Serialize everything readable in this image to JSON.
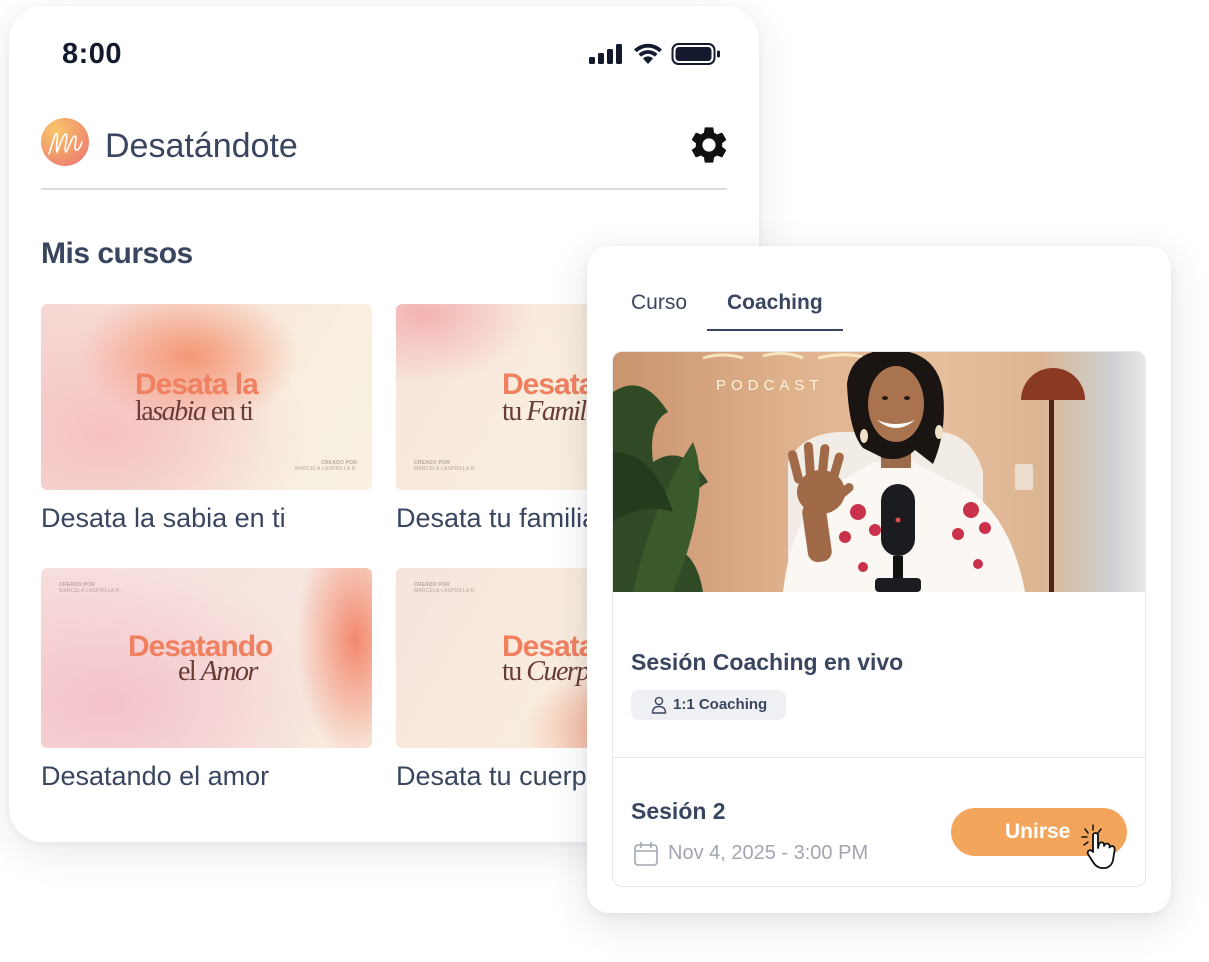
{
  "status_bar": {
    "time": "8:00",
    "icons": [
      "signal-icon",
      "wifi-icon",
      "battery-icon"
    ]
  },
  "app": {
    "name": "Desatándote",
    "logo": "brand-logo-m",
    "settings_icon": "gear-icon"
  },
  "section_title": "Mis cursos",
  "courses": [
    {
      "label": "Desata la sabia en ti",
      "thumb_line1": "Desata la",
      "thumb_line2_a": "la",
      "thumb_line2_b": "sabia",
      "thumb_line2_c": " en ti",
      "credit_a": "CREADO POR",
      "credit_b": "MARCELA LASPRILLA R."
    },
    {
      "label": "Desata tu familia",
      "thumb_line1": "Desata",
      "thumb_line2_a": "tu ",
      "thumb_line2_b": "Familia",
      "credit_a": "CREADO POR",
      "credit_b": "MARCELA LASPRILLA R."
    },
    {
      "label": "Desatando el amor",
      "thumb_line1": "Desatando",
      "thumb_line2_a": "el ",
      "thumb_line2_b": "Amor",
      "credit_a": "CREADO POR",
      "credit_b": "MARCELA LASPRILLA R."
    },
    {
      "label": "Desata tu cuerpo",
      "thumb_line1": "Desata",
      "thumb_line2_a": "tu ",
      "thumb_line2_b": "Cuerpo",
      "credit_a": "CREADO POR",
      "credit_b": "MARCELA LASPRILLA R."
    }
  ],
  "coaching": {
    "tabs": [
      {
        "label": "Curso",
        "active": false
      },
      {
        "label": "Coaching",
        "active": true
      }
    ],
    "video_sign": "PODCAST",
    "session_title": "Sesión Coaching en vivo",
    "badge": "1:1 Coaching",
    "next_session": {
      "title": "Sesión 2",
      "date": "Nov 4, 2025 - 3:00 PM",
      "join_label": "Unirse"
    }
  },
  "colors": {
    "text_primary": "#3a4660",
    "accent_orange": "#f3a55c",
    "title_coral": "#ef8060",
    "muted": "#a0a6b2"
  }
}
